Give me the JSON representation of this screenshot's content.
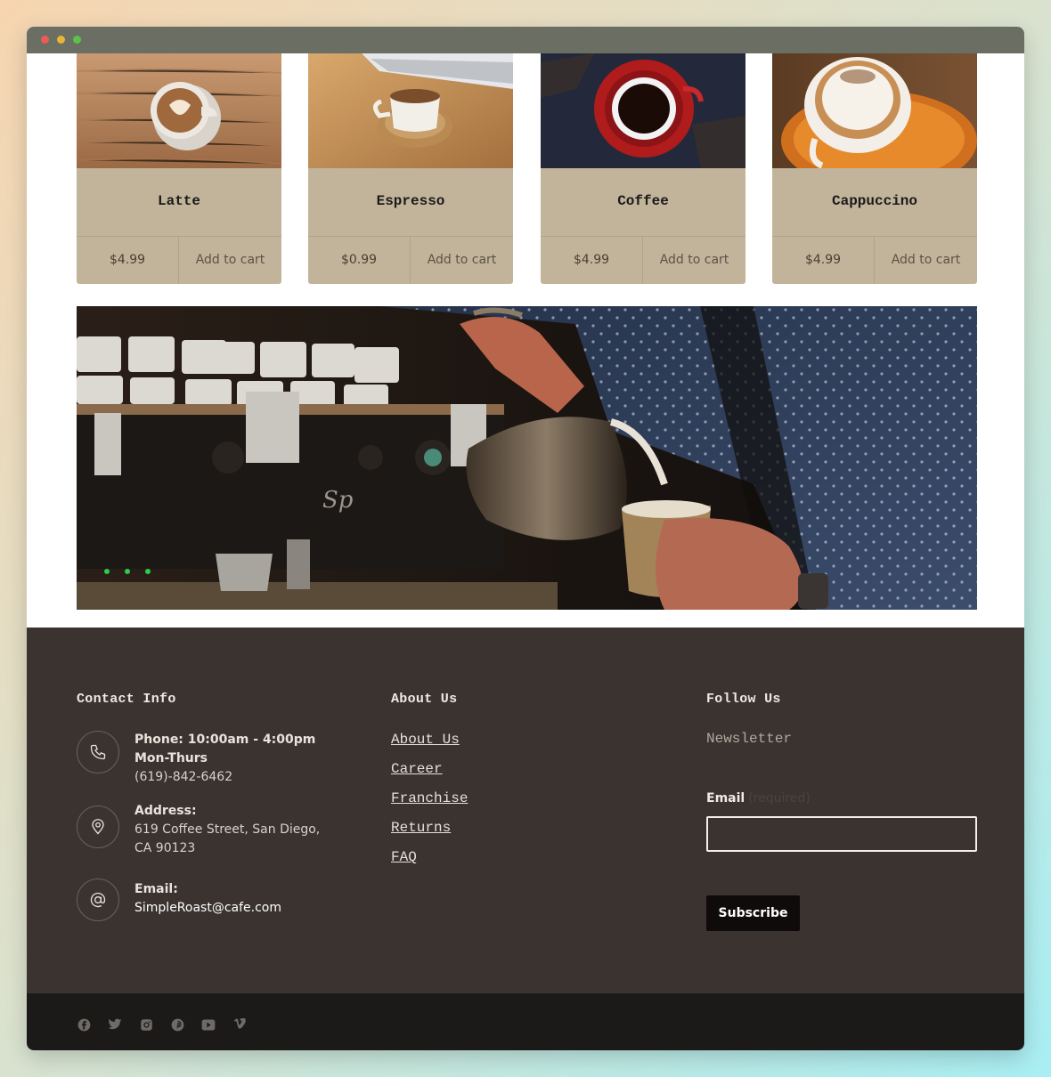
{
  "window": {
    "dots": [
      "close",
      "minimize",
      "zoom"
    ]
  },
  "products": [
    {
      "name": "Latte",
      "price": "$4.99",
      "cart_label": "Add to cart"
    },
    {
      "name": "Espresso",
      "price": "$0.99",
      "cart_label": "Add to cart"
    },
    {
      "name": "Coffee",
      "price": "$4.99",
      "cart_label": "Add to cart"
    },
    {
      "name": "Cappuccino",
      "price": "$4.99",
      "cart_label": "Add to cart"
    }
  ],
  "footer": {
    "contact": {
      "title": "Contact Info",
      "phone_label": "Phone: 10:00am - 4:00pm Mon-Thurs",
      "phone_value": "(619)-842-6462",
      "address_label": "Address:",
      "address_value": "619 Coffee Street, San Diego, CA 90123",
      "email_label": "Email:",
      "email_value": "SimpleRoast@cafe.com"
    },
    "about": {
      "title": "About Us",
      "links": [
        "About Us",
        "Career",
        "Franchise",
        "Returns",
        "FAQ"
      ]
    },
    "follow": {
      "title": "Follow Us",
      "newsletter": "Newsletter",
      "email_field_label": "Email",
      "email_required": "(required)",
      "subscribe_label": "Subscribe"
    }
  },
  "social_icons": [
    "facebook-icon",
    "twitter-icon",
    "instagram-icon",
    "pinterest-icon",
    "youtube-icon",
    "vimeo-icon"
  ]
}
